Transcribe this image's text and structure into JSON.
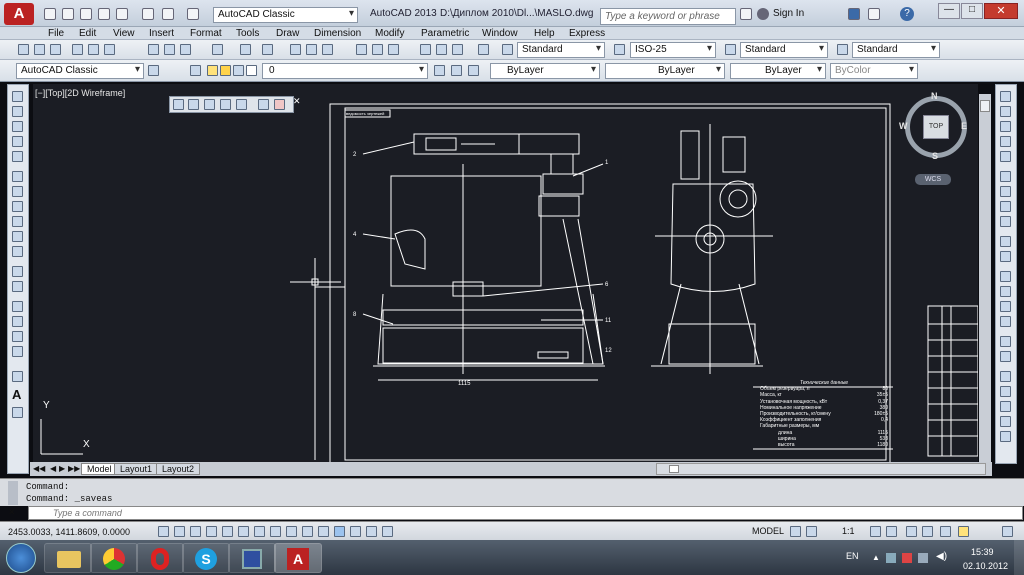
{
  "title_bar": {
    "workspace": "AutoCAD Classic",
    "app_version": "AutoCAD 2013",
    "file_path": "D:\\Диплом 2010\\Dl...\\MASLO.dwg",
    "search_placeholder": "Type a keyword or phrase",
    "sign_in": "Sign In"
  },
  "menu": [
    "File",
    "Edit",
    "View",
    "Insert",
    "Format",
    "Tools",
    "Draw",
    "Dimension",
    "Modify",
    "Parametric",
    "Window",
    "Help",
    "Express"
  ],
  "styles": {
    "text_style": "Standard",
    "dim_style": "ISO-25",
    "table_style": "Standard",
    "mleader_style": "Standard"
  },
  "layers": {
    "workspace": "AutoCAD Classic",
    "current_layer": "0",
    "color": "ByLayer",
    "linetype": "ByLayer",
    "lineweight": "ByLayer",
    "plotstyle": "ByColor"
  },
  "viewport": {
    "label": "[−][Top][2D Wireframe]",
    "viewcube_top": "TOP",
    "compass": {
      "n": "N",
      "s": "S",
      "e": "E",
      "w": "W"
    },
    "wcs": "WCS",
    "ucs_x": "X",
    "ucs_y": "Y"
  },
  "drawing": {
    "title_block": "ведомость чертежей",
    "spec_title": "Технические данные",
    "spec_rows": [
      [
        "Объем резервуара, л",
        "80"
      ],
      [
        "Масса, кг",
        "35±5"
      ],
      [
        "Установочная мощность, кВт",
        "0,37"
      ],
      [
        "Номинальное напряжение",
        "380"
      ],
      [
        "Производительность, кг/смену",
        "180±5"
      ],
      [
        "Коэффициент заполнения",
        "0,4"
      ],
      [
        "Габаритные размеры, мм",
        ""
      ],
      [
        "длина",
        "1115"
      ],
      [
        "ширина",
        "538"
      ],
      [
        "высота",
        "1180"
      ]
    ],
    "callouts": [
      "1",
      "2",
      "3",
      "4",
      "5",
      "6",
      "7",
      "8",
      "9",
      "10",
      "11",
      "12"
    ],
    "dim_bottom": "1115"
  },
  "tabs": {
    "model": "Model",
    "layout1": "Layout1",
    "layout2": "Layout2"
  },
  "command": {
    "history": [
      "Command:",
      "Command: _saveas"
    ],
    "placeholder": "Type a command"
  },
  "status": {
    "coords": "2453.0033, 1411.8609, 0.0000",
    "model": "MODEL",
    "scale": "1:1"
  },
  "taskbar": {
    "lang": "EN",
    "time": "15:39",
    "date": "02.10.2012"
  },
  "colors": {
    "canvas": "#1b1d24",
    "drawing_lines": "#ffffff",
    "accent": "#3b6aa8"
  }
}
